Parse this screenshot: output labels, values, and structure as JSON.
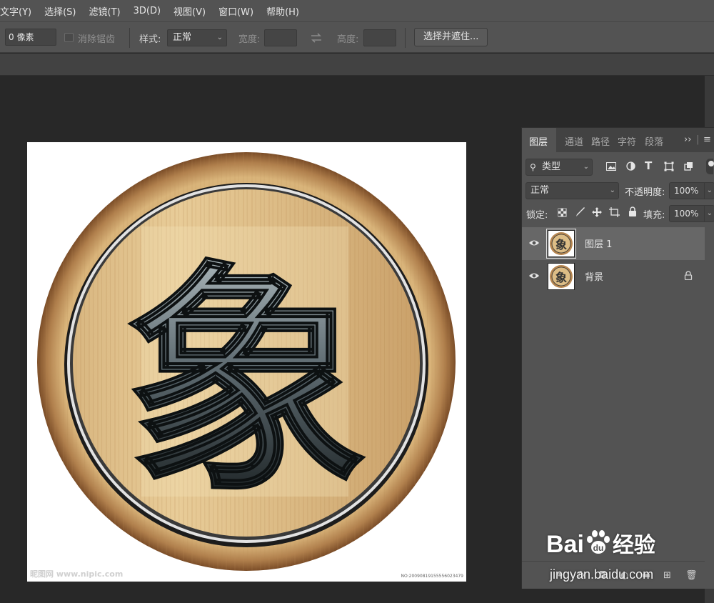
{
  "menu": [
    "文字(Y)",
    "选择(S)",
    "滤镜(T)",
    "3D(D)",
    "视图(V)",
    "窗口(W)",
    "帮助(H)"
  ],
  "options": {
    "feather_value": "0 像素",
    "antialias_label": "消除锯齿",
    "style_label": "样式:",
    "style_value": "正常",
    "width_label": "宽度:",
    "height_label": "高度:",
    "select_mask_button": "选择并遮住..."
  },
  "document": {
    "character": "象",
    "watermark_left": "昵图网 www.nipic.com",
    "watermark_right": "NO:20090819155556023479"
  },
  "layers_panel": {
    "tabs": [
      "图层",
      "通道",
      "路径",
      "字符",
      "段落"
    ],
    "filter_kind": "类型",
    "blend_mode": "正常",
    "opacity_label": "不透明度:",
    "opacity_value": "100%",
    "lock_label": "锁定:",
    "fill_label": "填充:",
    "fill_value": "100%",
    "layers": [
      {
        "name": "图层 1",
        "selected": true,
        "locked": false
      },
      {
        "name": "背景",
        "selected": false,
        "locked": true
      }
    ],
    "bottom_icons": [
      "link-icon",
      "fx-icon",
      "mask-icon",
      "adjustment-icon",
      "folder-icon",
      "new-layer-icon",
      "trash-icon"
    ]
  },
  "watermark": {
    "brand": "Bai",
    "brand_suffix": "经验",
    "url": "jingyan.baidu.com"
  },
  "colors": {
    "ui_dark": "#535353",
    "canvas_bg": "#282828",
    "wood_light": "#e2c38d",
    "wood_dark": "#8a5a32"
  }
}
